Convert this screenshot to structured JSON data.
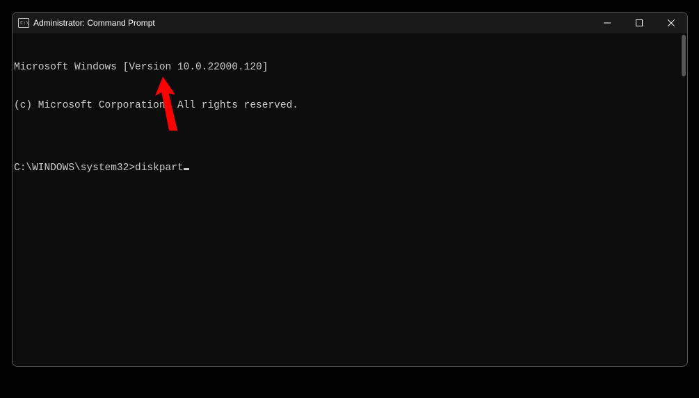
{
  "window": {
    "title": "Administrator: Command Prompt"
  },
  "terminal": {
    "line1": "Microsoft Windows [Version 10.0.22000.120]",
    "line2": "(c) Microsoft Corporation. All rights reserved.",
    "blank": "",
    "prompt": "C:\\WINDOWS\\system32>",
    "command": "diskpart"
  }
}
